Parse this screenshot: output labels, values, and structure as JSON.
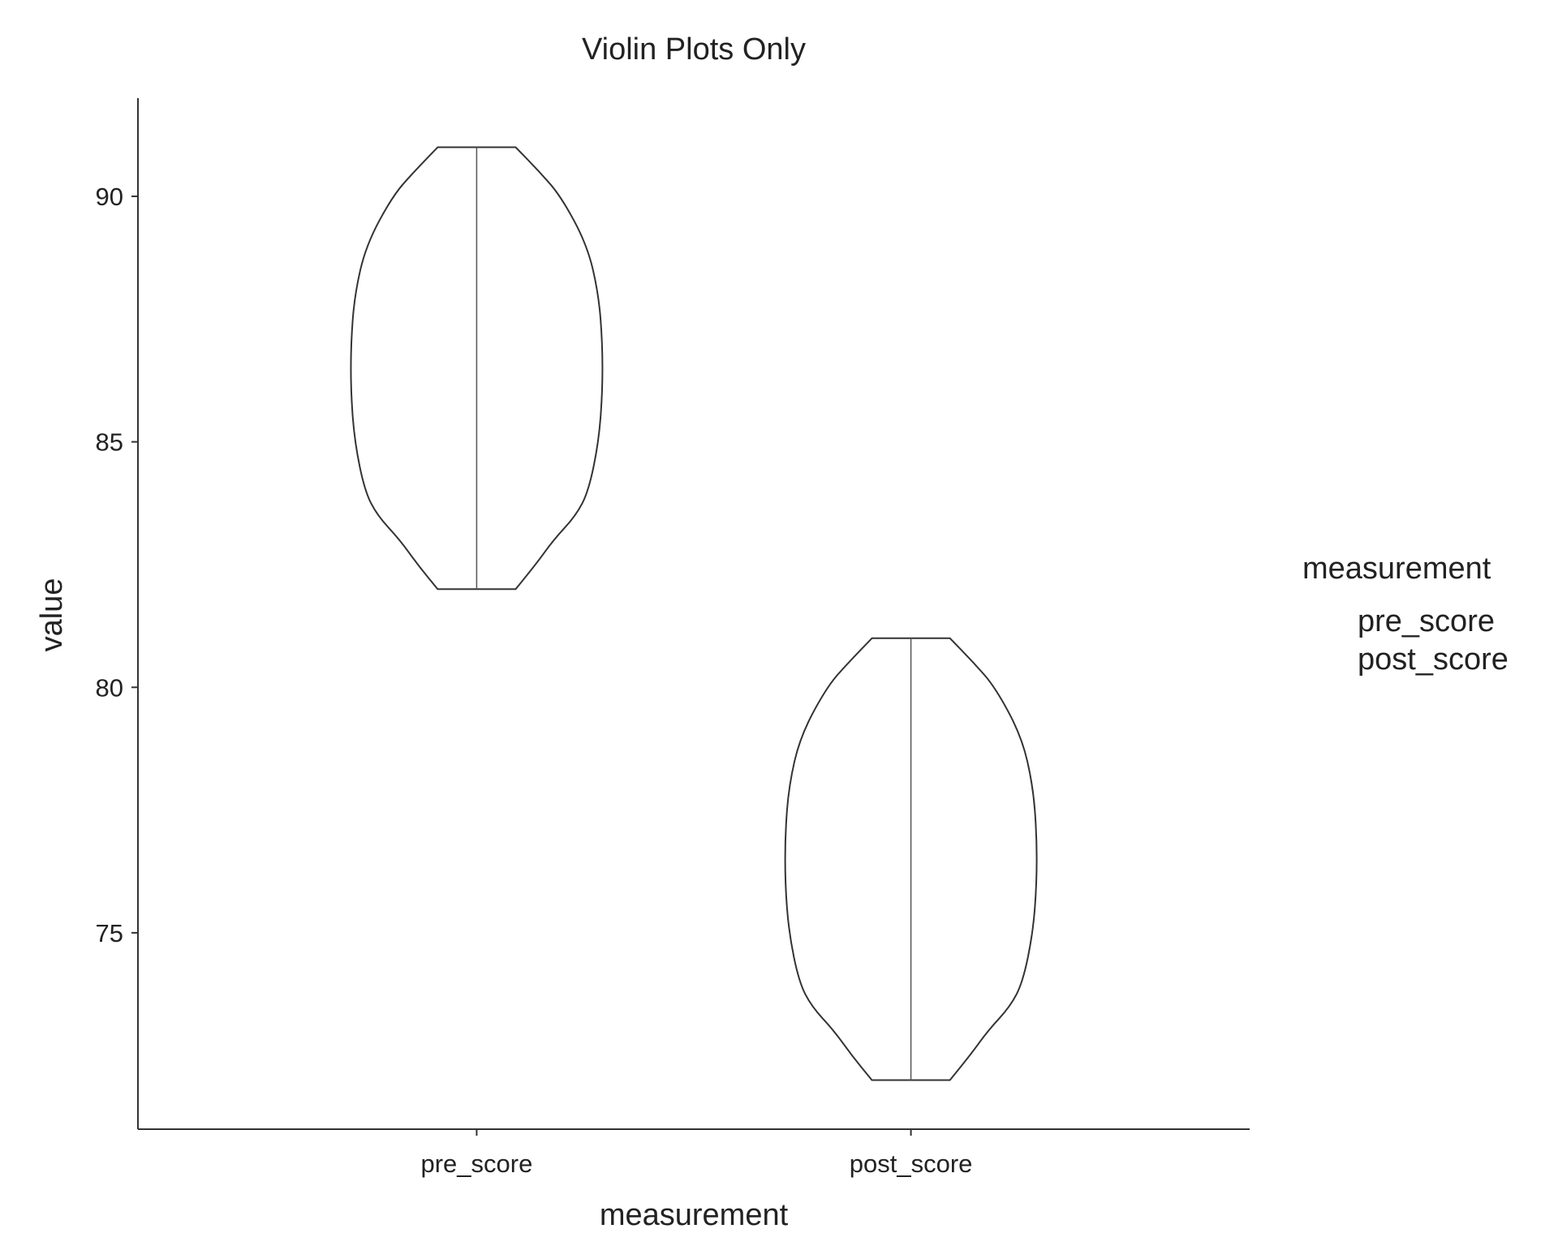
{
  "chart_data": {
    "type": "violin",
    "title": "Violin Plots Only",
    "xlabel": "measurement",
    "ylabel": "value",
    "ylim": [
      71,
      92
    ],
    "yticks": [
      75,
      80,
      85,
      90
    ],
    "grid": false,
    "legend": {
      "title": "measurement",
      "entries": [
        "pre_score",
        "post_score"
      ],
      "placement": "right"
    },
    "categories": [
      "pre_score",
      "post_score"
    ],
    "series": [
      {
        "name": "pre_score",
        "min": 82,
        "max": 91,
        "density": [
          [
            82,
            0.31
          ],
          [
            82.5,
            0.47
          ],
          [
            83,
            0.61
          ],
          [
            83.5,
            0.79
          ],
          [
            84,
            0.89
          ],
          [
            85,
            0.97
          ],
          [
            86,
            1.0
          ],
          [
            87,
            1.0
          ],
          [
            88,
            0.97
          ],
          [
            89,
            0.88
          ],
          [
            90,
            0.67
          ],
          [
            90.5,
            0.5
          ],
          [
            91,
            0.31
          ]
        ]
      },
      {
        "name": "post_score",
        "min": 72,
        "max": 81,
        "density": [
          [
            72,
            0.31
          ],
          [
            72.5,
            0.47
          ],
          [
            73,
            0.61
          ],
          [
            73.5,
            0.79
          ],
          [
            74,
            0.89
          ],
          [
            75,
            0.97
          ],
          [
            76,
            1.0
          ],
          [
            77,
            1.0
          ],
          [
            78,
            0.97
          ],
          [
            79,
            0.88
          ],
          [
            80,
            0.67
          ],
          [
            80.5,
            0.5
          ],
          [
            81,
            0.31
          ]
        ]
      }
    ]
  }
}
